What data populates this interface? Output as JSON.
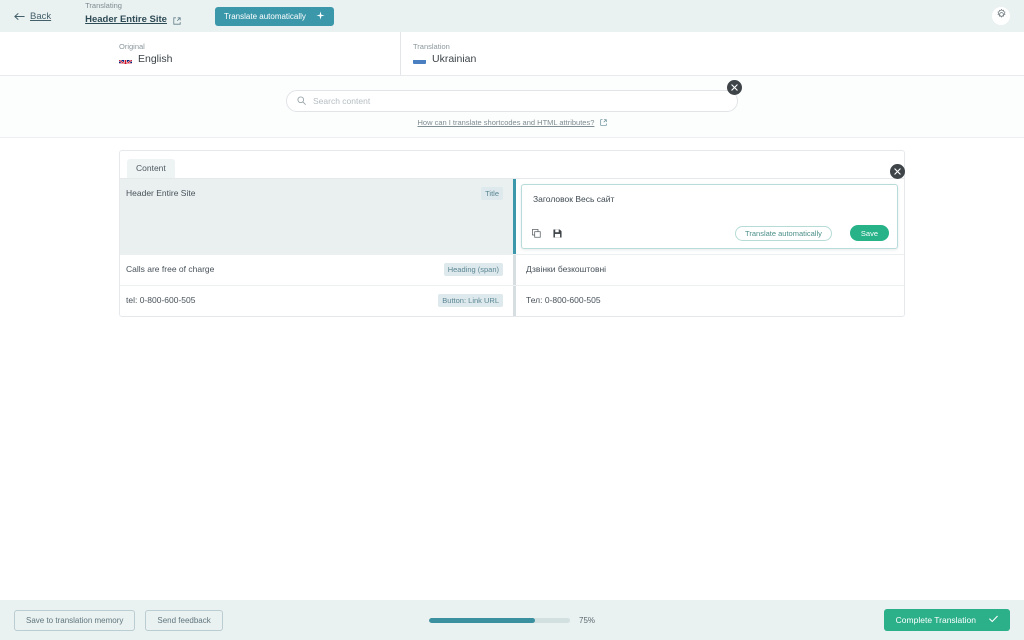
{
  "topbar": {
    "back_label": "Back",
    "translating_label": "Translating",
    "document_title": "Header Entire Site",
    "translate_button": "Translate automatically",
    "settings_icon": "gear-icon",
    "back_icon": "arrow-left-icon",
    "external_link_icon": "external-link-icon",
    "sparkle_icon": "sparkle-icon"
  },
  "languages": {
    "original": {
      "label": "Original",
      "name": "English",
      "flag": "flag-uk"
    },
    "translation": {
      "label": "Translation",
      "name": "Ukrainian",
      "flag": "flag-ua"
    }
  },
  "search": {
    "placeholder": "Search content",
    "value": "",
    "icon": "search-icon",
    "help_text": "How can I translate shortcodes and HTML attributes?",
    "close_icon": "close-icon"
  },
  "card": {
    "tabs": [
      {
        "label": "Content",
        "active": true
      }
    ],
    "rows": [
      {
        "source": "Header Entire Site",
        "badge": "Title",
        "target": "Заголовок Весь сайт",
        "selected": true
      },
      {
        "source": "Calls are free of charge",
        "badge": "Heading (span)",
        "target": "Дзвінки безкоштовні",
        "selected": false
      },
      {
        "source": "tel: 0-800-600-505",
        "badge": "Button: Link URL",
        "target": "Тел: 0-800-600-505",
        "selected": false
      }
    ]
  },
  "editor": {
    "value": "Заголовок Весь сайт",
    "copy_icon": "copy-icon",
    "save-disk_icon": "save-disk-icon",
    "translate_button": "Translate automatically",
    "save_button": "Save",
    "close_icon": "close-icon"
  },
  "footer": {
    "save_memory_button": "Save to translation memory",
    "feedback_button": "Send feedback",
    "progress_percent": 75,
    "progress_label": "75%",
    "complete_button": "Complete Translation",
    "check_icon": "check-icon"
  },
  "colors": {
    "header_bg": "#eaf1f1",
    "accent_teal": "#3b98ab",
    "accent_green": "#27b288",
    "badge_bg": "#dde9ec"
  }
}
